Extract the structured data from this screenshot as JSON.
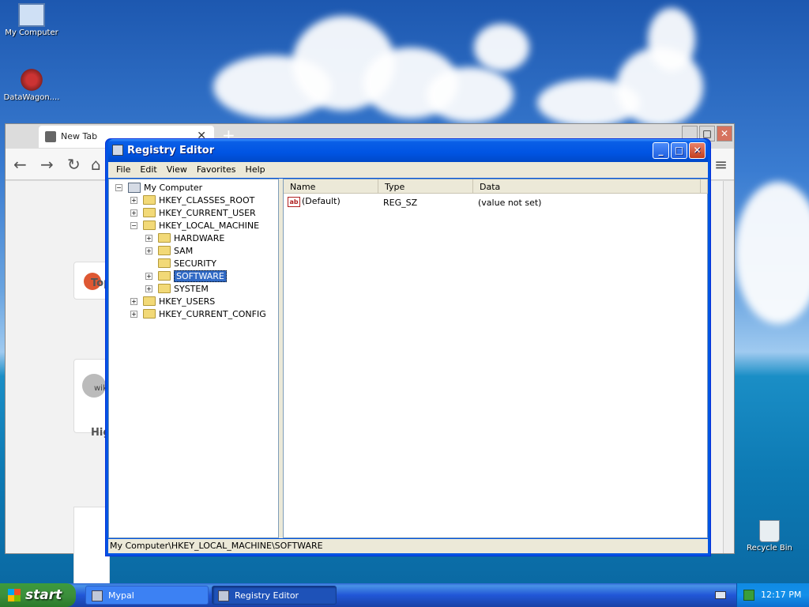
{
  "desktop": {
    "icons": [
      {
        "label": "My Computer",
        "icon": "computer-icon"
      },
      {
        "label": "DataWagon....",
        "icon": "datawagon-shortcut-icon"
      },
      {
        "label": "Recycle Bin",
        "icon": "recycle-bin-icon"
      }
    ]
  },
  "browser": {
    "tab_title": "New Tab",
    "tab_close": "✕",
    "new_tab": "+",
    "back": "←",
    "forward": "→",
    "reload": "↻",
    "home": "⌂",
    "menu": "≡",
    "partial_texts": [
      "Top",
      "wik",
      "Hig"
    ]
  },
  "registry_editor": {
    "title": "Registry Editor",
    "title_buttons": {
      "minimize": "_",
      "maximize": "□",
      "close": "✕"
    },
    "menu": [
      "File",
      "Edit",
      "View",
      "Favorites",
      "Help"
    ],
    "tree": [
      {
        "label": "My Computer",
        "expander": "−"
      },
      {
        "label": "HKEY_CLASSES_ROOT",
        "expander": "+"
      },
      {
        "label": "HKEY_CURRENT_USER",
        "expander": "+"
      },
      {
        "label": "HKEY_LOCAL_MACHINE",
        "expander": "−"
      },
      {
        "label": "HARDWARE",
        "expander": "+"
      },
      {
        "label": "SAM",
        "expander": "+"
      },
      {
        "label": "SECURITY",
        "expander": ""
      },
      {
        "label": "SOFTWARE",
        "expander": "+",
        "selected": true
      },
      {
        "label": "SYSTEM",
        "expander": "+"
      },
      {
        "label": "HKEY_USERS",
        "expander": "+"
      },
      {
        "label": "HKEY_CURRENT_CONFIG",
        "expander": "+"
      }
    ],
    "columns": [
      "Name",
      "Type",
      "Data"
    ],
    "rows": [
      {
        "icon_text": "ab",
        "name": "(Default)",
        "type": "REG_SZ",
        "data": "(value not set)"
      }
    ],
    "status": "My Computer\\HKEY_LOCAL_MACHINE\\SOFTWARE"
  },
  "taskbar": {
    "start_label": "start",
    "tasks": [
      {
        "label": "Mypal",
        "active": false
      },
      {
        "label": "Registry Editor",
        "active": true
      }
    ],
    "clock": "12:17 PM"
  },
  "colors": {
    "xp_blue": "#0054e3",
    "selection": "#316ac5",
    "start_green": "#3c8f3c"
  }
}
